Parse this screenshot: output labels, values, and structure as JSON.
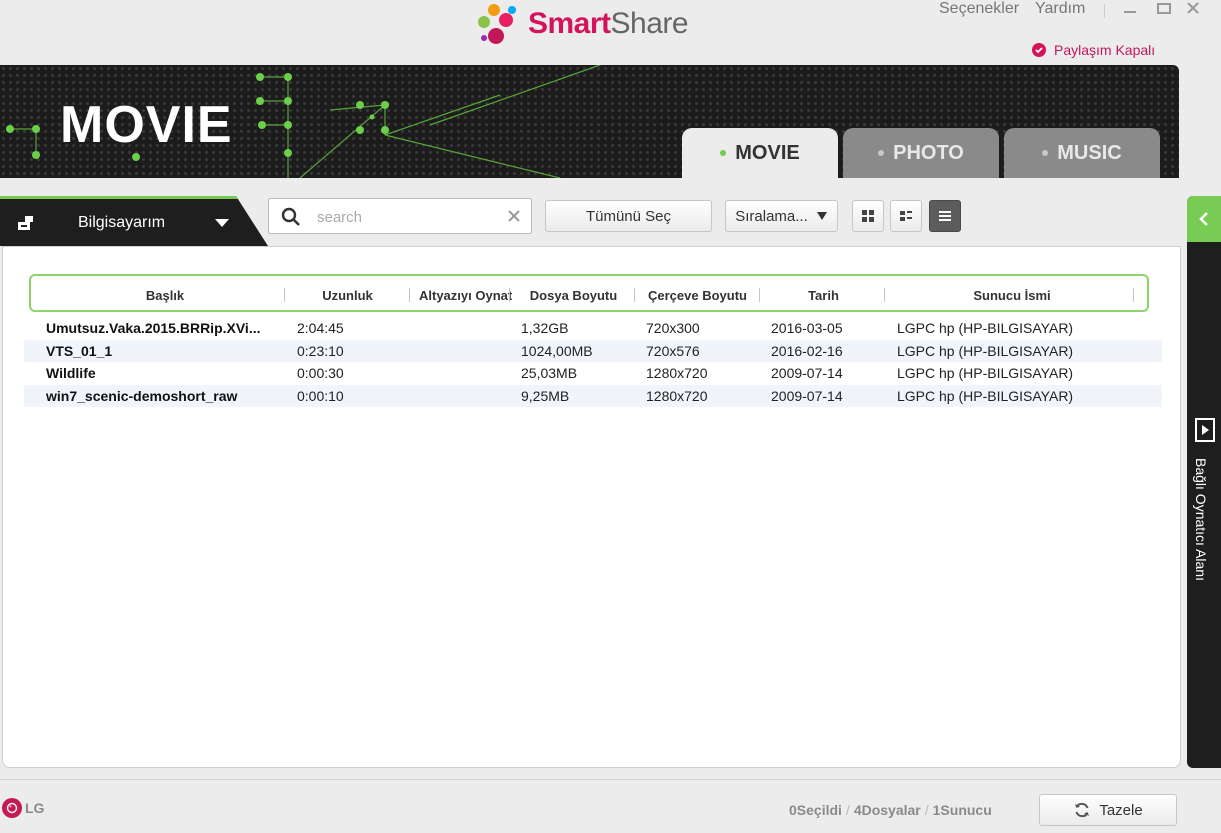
{
  "app": {
    "logo_brand_smart": "Smart",
    "logo_brand_share": "Share",
    "menu": [
      "Seçenekler",
      "Yardım"
    ],
    "window_controls": [
      "minimize-icon",
      "maximize-icon",
      "close-icon"
    ],
    "share_status": "Paylaşım Kapalı"
  },
  "banner": {
    "title": "MOVIE",
    "tabs": [
      {
        "label": "MOVIE",
        "active": true
      },
      {
        "label": "PHOTO",
        "active": false
      },
      {
        "label": "MUSIC",
        "active": false
      }
    ]
  },
  "toolbar": {
    "device": "Bilgisayarım",
    "search_placeholder": "search",
    "search_value": "",
    "select_all": "Tümünü Seç",
    "sort": "Sıralama...",
    "view_modes": [
      "grid-view-icon",
      "detail-view-icon",
      "list-view-icon"
    ],
    "active_view": "list-view-icon"
  },
  "table": {
    "columns": [
      "Başlık",
      "Uzunluk",
      "Altyazıyı Oynat",
      "Dosya Boyutu",
      "Çerçeve Boyutu",
      "Tarih",
      "Sunucu İsmi"
    ],
    "rows": [
      {
        "title": "Umutsuz.Vaka.2015.BRRip.XVi...",
        "length": "2:04:45",
        "subtitle": "",
        "size": "1,32GB",
        "frame": "720x300",
        "date": "2016-03-05",
        "server": "LGPC hp (HP-BILGISAYAR)"
      },
      {
        "title": "VTS_01_1",
        "length": "0:23:10",
        "subtitle": "",
        "size": "1024,00MB",
        "frame": "720x576",
        "date": "2016-02-16",
        "server": "LGPC hp (HP-BILGISAYAR)"
      },
      {
        "title": "Wildlife",
        "length": "0:00:30",
        "subtitle": "",
        "size": "25,03MB",
        "frame": "1280x720",
        "date": "2009-07-14",
        "server": "LGPC hp (HP-BILGISAYAR)"
      },
      {
        "title": "win7_scenic-demoshort_raw",
        "length": "0:00:10",
        "subtitle": "",
        "size": "9,25MB",
        "frame": "1280x720",
        "date": "2009-07-14",
        "server": "LGPC hp (HP-BILGISAYAR)"
      }
    ]
  },
  "side_panel": {
    "label": "Bağlı Oynatıcı Alanı"
  },
  "footer": {
    "brand": "LG",
    "selected": "0Seçildi",
    "files": "4Dosyalar",
    "servers": "1Sunucu",
    "refresh": "Tazele"
  },
  "colors": {
    "accent_pink": "#d4145a",
    "accent_green": "#78cc54",
    "banner_bg": "#1c1c1c"
  }
}
